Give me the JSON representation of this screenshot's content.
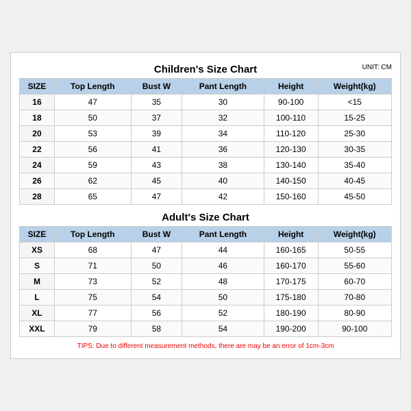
{
  "children": {
    "title": "Children's Size Chart",
    "unit": "UNIT: CM",
    "headers": [
      "SIZE",
      "Top Length",
      "Bust W",
      "Pant Length",
      "Height",
      "Weight(kg)"
    ],
    "rows": [
      [
        "16",
        "47",
        "35",
        "30",
        "90-100",
        "<15"
      ],
      [
        "18",
        "50",
        "37",
        "32",
        "100-110",
        "15-25"
      ],
      [
        "20",
        "53",
        "39",
        "34",
        "110-120",
        "25-30"
      ],
      [
        "22",
        "56",
        "41",
        "36",
        "120-130",
        "30-35"
      ],
      [
        "24",
        "59",
        "43",
        "38",
        "130-140",
        "35-40"
      ],
      [
        "26",
        "62",
        "45",
        "40",
        "140-150",
        "40-45"
      ],
      [
        "28",
        "65",
        "47",
        "42",
        "150-160",
        "45-50"
      ]
    ]
  },
  "adults": {
    "title": "Adult's Size Chart",
    "headers": [
      "SIZE",
      "Top Length",
      "Bust W",
      "Pant Length",
      "Height",
      "Weight(kg)"
    ],
    "rows": [
      [
        "XS",
        "68",
        "47",
        "44",
        "160-165",
        "50-55"
      ],
      [
        "S",
        "71",
        "50",
        "46",
        "160-170",
        "55-60"
      ],
      [
        "M",
        "73",
        "52",
        "48",
        "170-175",
        "60-70"
      ],
      [
        "L",
        "75",
        "54",
        "50",
        "175-180",
        "70-80"
      ],
      [
        "XL",
        "77",
        "56",
        "52",
        "180-190",
        "80-90"
      ],
      [
        "XXL",
        "79",
        "58",
        "54",
        "190-200",
        "90-100"
      ]
    ]
  },
  "tips": "TIPS: Due to different measurement methods, there are may be an error of 1cm-3cm"
}
